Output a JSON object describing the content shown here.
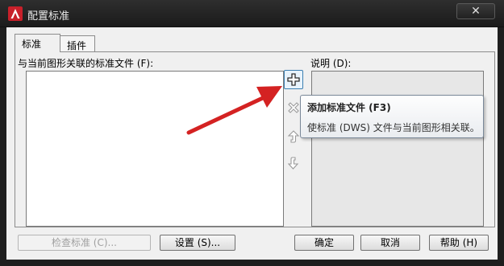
{
  "window": {
    "title": "配置标准",
    "close_symbol": "✕",
    "app_icon": "autocad-logo-icon"
  },
  "tabs": [
    {
      "label": "标准",
      "active": true
    },
    {
      "label": "插件",
      "active": false
    }
  ],
  "standards_panel": {
    "files_label": "与当前图形关联的标准文件 (F):",
    "description_label": "说明 (D):",
    "files": []
  },
  "side_buttons": {
    "add_icon": "plus-icon",
    "remove_icon": "x-icon",
    "move_up_icon": "up-arrow-icon",
    "move_down_icon": "down-arrow-icon"
  },
  "tooltip": {
    "title": "添加标准文件 (F3)",
    "description": "使标准 (DWS) 文件与当前图形相关联。"
  },
  "buttons": {
    "check": "检查标准 (C)...",
    "settings": "设置 (S)...",
    "ok": "确定",
    "cancel": "取消",
    "help": "帮助 (H)"
  },
  "colors": {
    "annotation_arrow": "#d42222",
    "titlebar": "#1e1e1e",
    "dialog_background": "#f0f0f0"
  }
}
